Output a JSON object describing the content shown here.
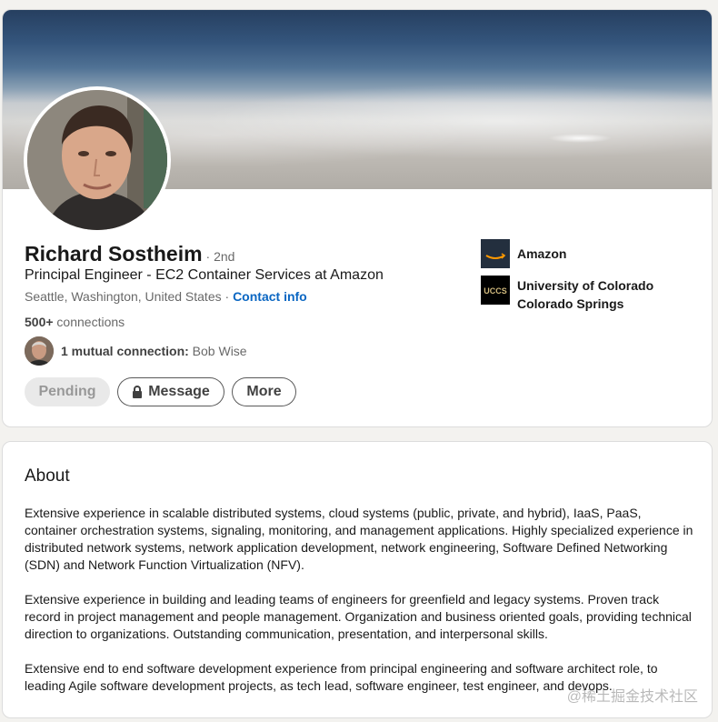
{
  "profile": {
    "name": "Richard Sostheim",
    "degree": "· 2nd",
    "headline": "Principal Engineer - EC2 Container Services at Amazon",
    "location": "Seattle, Washington, United States",
    "separator": " · ",
    "contact_info": "Contact info",
    "connections_count": "500+",
    "connections_label": " connections",
    "mutual_label": "1 mutual connection:",
    "mutual_name": " Bob Wise"
  },
  "actions": {
    "pending": "Pending",
    "message": "Message",
    "more": "More"
  },
  "orgs": [
    {
      "name": "Amazon",
      "logo_icon": "amazon-logo"
    },
    {
      "name": "University of Colorado Colorado Springs",
      "logo_text": "UCCS",
      "logo_icon": "uccs-logo"
    }
  ],
  "about": {
    "title": "About",
    "paragraphs": [
      "Extensive experience in scalable distributed systems, cloud systems (public, private, and hybrid), IaaS, PaaS, container orchestration systems, signaling, monitoring, and management applications. Highly specialized experience in distributed network systems, network application development, network engineering, Software Defined Networking (SDN) and Network Function Virtualization (NFV).",
      "Extensive experience in building and leading teams of engineers for greenfield and legacy systems. Proven track record in project management and people management. Organization and business oriented goals, providing technical direction to organizations. Outstanding communication, presentation, and interpersonal skills.",
      "Extensive end to end software development experience from principal engineering and software architect role, to leading Agile software development projects, as tech lead, software engineer, test engineer, and devops."
    ]
  },
  "watermark": "@稀土掘金技术社区",
  "colors": {
    "link": "#0a66c2",
    "amazon_bg": "#232f3e",
    "amazon_smile": "#ff9900",
    "uccs_gold": "#cfb87c"
  }
}
